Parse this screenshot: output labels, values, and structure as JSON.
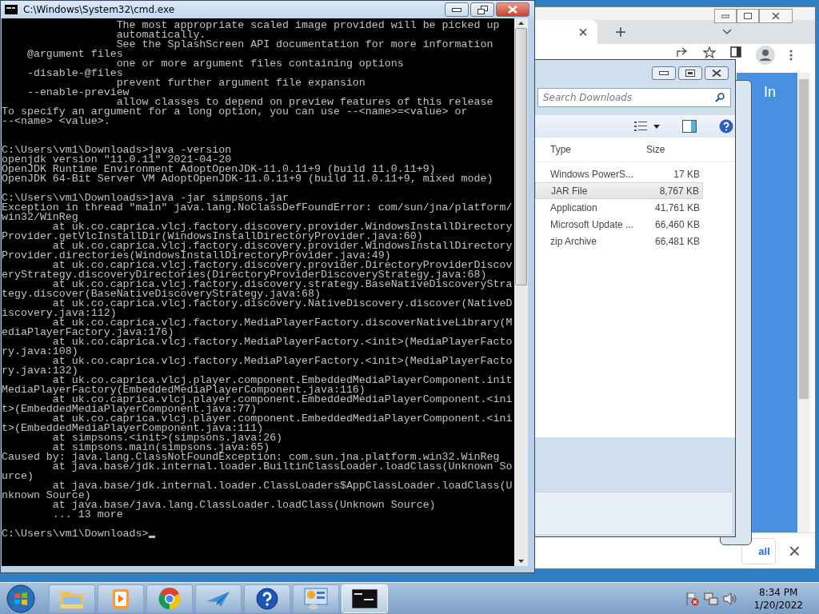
{
  "console": {
    "title": "C:\\Windows\\System32\\cmd.exe",
    "blocks": [
      [
        "                  The most appropriate scaled image provided will be picked up",
        "                  automatically.",
        "                  See the SplashScreen API documentation for more information",
        "    @argument files",
        "                  one or more argument files containing options",
        "    -disable-@files",
        "                  prevent further argument file expansion",
        "    --enable-preview",
        "                  allow classes to depend on preview features of this release",
        "To specify an argument for a long option, you can use --<name>=<value> or",
        "--<name> <value>."
      ],
      [
        "C:\\Users\\vm1\\Downloads>java -version",
        "openjdk version \"11.0.11\" 2021-04-20",
        "OpenJDK Runtime Environment AdoptOpenJDK-11.0.11+9 (build 11.0.11+9)",
        "OpenJDK 64-Bit Server VM AdoptOpenJDK-11.0.11+9 (build 11.0.11+9, mixed mode)"
      ],
      [
        "C:\\Users\\vm1\\Downloads>java -jar simpsons.jar",
        "Exception in thread \"main\" java.lang.NoClassDefFoundError: com/sun/jna/platform/",
        "win32/WinReg",
        "        at uk.co.caprica.vlcj.factory.discovery.provider.WindowsInstallDirectory",
        "Provider.getVlcInstallDir(WindowsInstallDirectoryProvider.java:60)",
        "        at uk.co.caprica.vlcj.factory.discovery.provider.WindowsInstallDirectory",
        "Provider.directories(WindowsInstallDirectoryProvider.java:49)",
        "        at uk.co.caprica.vlcj.factory.discovery.provider.DirectoryProviderDiscov",
        "eryStrategy.discoveryDirectories(DirectoryProviderDiscoveryStrategy.java:68)",
        "        at uk.co.caprica.vlcj.factory.discovery.strategy.BaseNativeDiscoveryStra",
        "tegy.discover(BaseNativeDiscoveryStrategy.java:68)",
        "        at uk.co.caprica.vlcj.factory.discovery.NativeDiscovery.discover(NativeD",
        "iscovery.java:112)",
        "        at uk.co.caprica.vlcj.factory.MediaPlayerFactory.discoverNativeLibrary(M",
        "ediaPlayerFactory.java:176)",
        "        at uk.co.caprica.vlcj.factory.MediaPlayerFactory.<init>(MediaPlayerFacto",
        "ry.java:108)",
        "        at uk.co.caprica.vlcj.factory.MediaPlayerFactory.<init>(MediaPlayerFacto",
        "ry.java:132)",
        "        at uk.co.caprica.vlcj.player.component.EmbeddedMediaPlayerComponent.init",
        "MediaPlayerFactory(EmbeddedMediaPlayerComponent.java:116)",
        "        at uk.co.caprica.vlcj.player.component.EmbeddedMediaPlayerComponent.<ini",
        "t>(EmbeddedMediaPlayerComponent.java:77)",
        "        at uk.co.caprica.vlcj.player.component.EmbeddedMediaPlayerComponent.<ini",
        "t>(EmbeddedMediaPlayerComponent.java:111)",
        "        at simpsons.<init>(simpsons.java:26)",
        "        at simpsons.main(simpsons.java:65)",
        "Caused by: java.lang.ClassNotFoundException: com.sun.jna.platform.win32.WinReg",
        "        at java.base/jdk.internal.loader.BuiltinClassLoader.loadClass(Unknown So",
        "urce)",
        "        at java.base/jdk.internal.loader.ClassLoaders$AppClassLoader.loadClass(U",
        "nknown Source)",
        "        at java.base/java.lang.ClassLoader.loadClass(Unknown Source)",
        "        ... 13 more"
      ],
      [
        "C:\\Users\\vm1\\Downloads>"
      ]
    ]
  },
  "browser": {
    "tab_close": "×",
    "new_tab": "+",
    "page_heading": "In",
    "download_bar_button": "all",
    "download_bar_close": "×"
  },
  "explorer": {
    "search": {
      "placeholder": "Search Downloads"
    },
    "columns": [
      "Type",
      "Size"
    ],
    "rows": [
      {
        "type": "Windows PowerS...",
        "size": "17 KB",
        "selected": false
      },
      {
        "type": "JAR File",
        "size": "8,767 KB",
        "selected": true
      },
      {
        "type": "Application",
        "size": "41,761 KB",
        "selected": false
      },
      {
        "type": "Microsoft Update ...",
        "size": "66,460 KB",
        "selected": false
      },
      {
        "type": "zip Archive",
        "size": "66,481 KB",
        "selected": false
      }
    ]
  },
  "taskbar": {
    "items": [
      {
        "kind": "folder",
        "selected": false
      },
      {
        "kind": "media",
        "selected": false
      },
      {
        "kind": "chrome",
        "selected": false
      },
      {
        "kind": "plane",
        "selected": false
      },
      {
        "kind": "help",
        "selected": false
      },
      {
        "kind": "panel",
        "selected": false
      },
      {
        "kind": "console",
        "selected": true
      }
    ],
    "clock": {
      "time": "8:34 PM",
      "date": "1/20/2022"
    }
  }
}
